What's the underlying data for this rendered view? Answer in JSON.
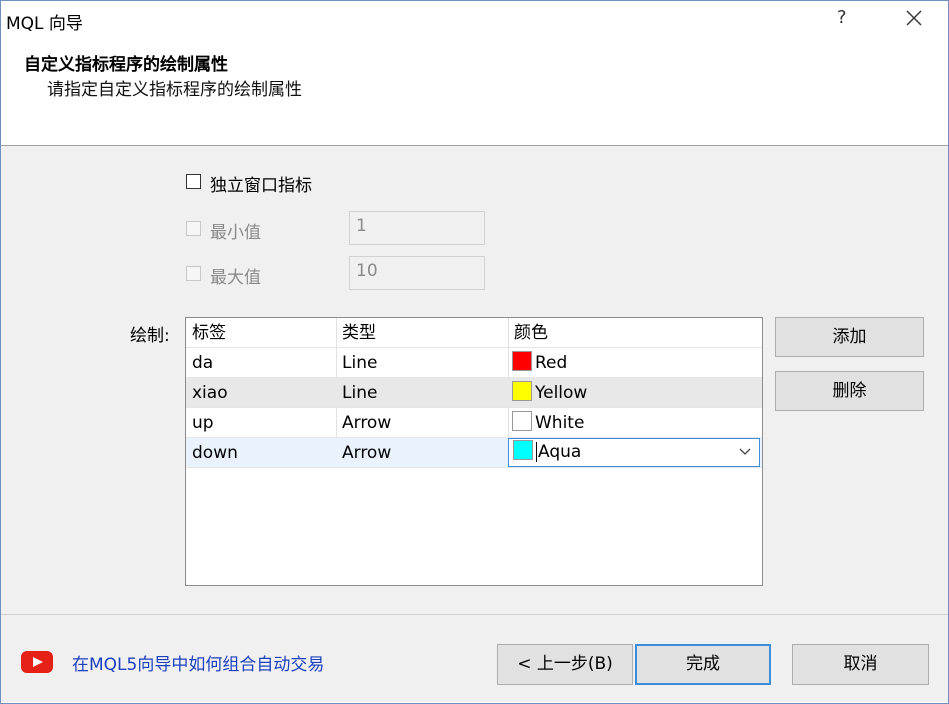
{
  "window": {
    "title": "MQL 向导",
    "help_glyph": "?"
  },
  "header": {
    "title": "自定义指标程序的绘制属性",
    "subtitle": "请指定自定义指标程序的绘制属性"
  },
  "options": {
    "separate_window_label": "独立窗口指标",
    "min_label": "最小值",
    "min_value": "1",
    "max_label": "最大值",
    "max_value": "10"
  },
  "plots": {
    "label": "绘制:",
    "columns": [
      "标签",
      "类型",
      "颜色"
    ],
    "rows": [
      {
        "label": "da",
        "type": "Line",
        "color_name": "Red",
        "color_hex": "#ff0000"
      },
      {
        "label": "xiao",
        "type": "Line",
        "color_name": "Yellow",
        "color_hex": "#ffff00"
      },
      {
        "label": "up",
        "type": "Arrow",
        "color_name": "White",
        "color_hex": "#ffffff"
      },
      {
        "label": "down",
        "type": "Arrow",
        "color_name": "Aqua",
        "color_hex": "#00ffff"
      }
    ],
    "add_button": "添加",
    "delete_button": "删除"
  },
  "footer": {
    "link_text": "在MQL5向导中如何组合自动交易",
    "back_button": "< 上一步(B)",
    "finish_button": "完成",
    "cancel_button": "取消"
  }
}
